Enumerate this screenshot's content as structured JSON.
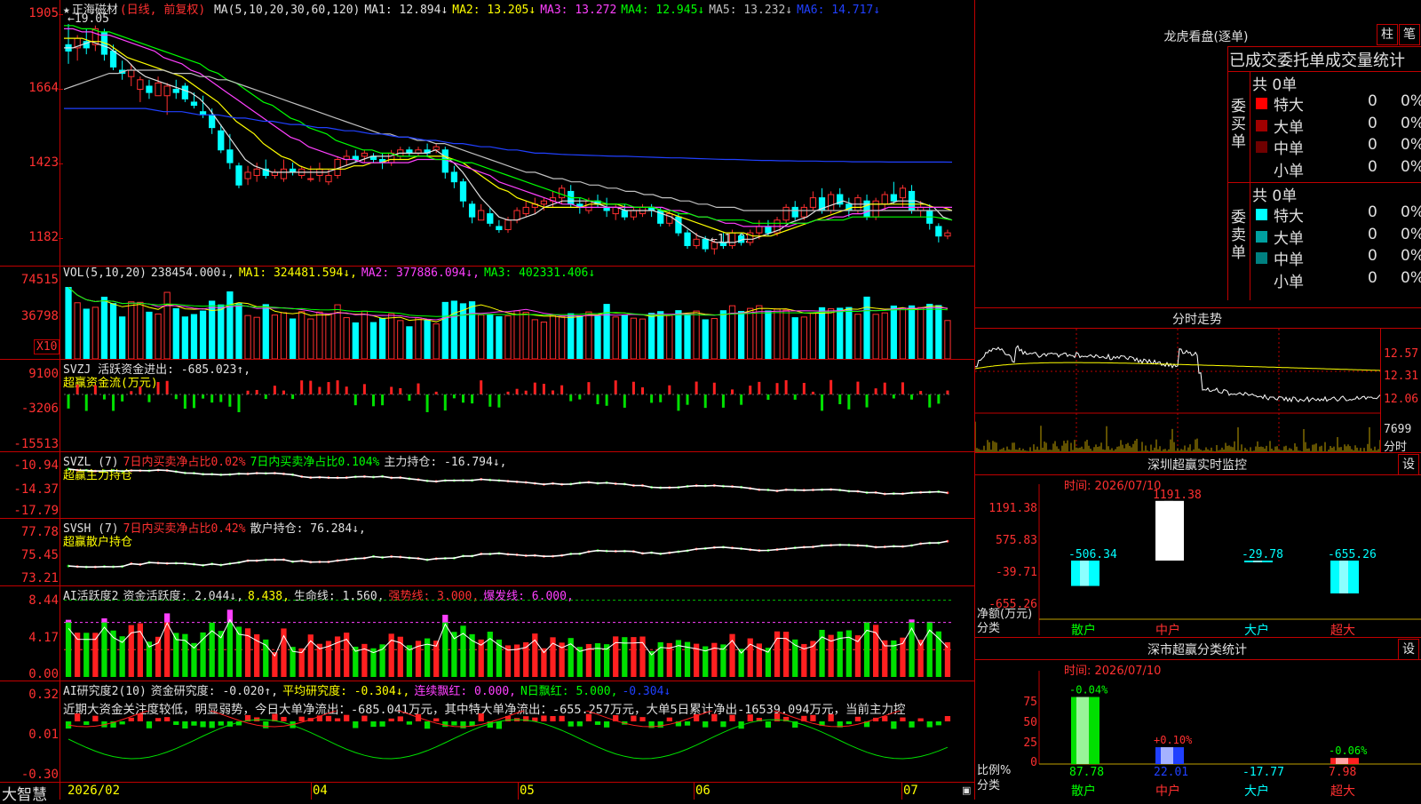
{
  "stock": {
    "star": "★",
    "name": "正海磁材",
    "period_tag": "(日线, 前复权)",
    "ma_legend": [
      {
        "label": "MA(5,10,20,30,60,120)",
        "color": "#e0e0e0"
      },
      {
        "label": "MA1: 12.894↓",
        "color": "#e0e0e0"
      },
      {
        "label": "MA2: 13.205↓",
        "color": "#ffff00"
      },
      {
        "label": "MA3: 13.272",
        "color": "#ff40ff"
      },
      {
        "label": "MA4: 12.945↓",
        "color": "#00ff00"
      },
      {
        "label": "MA5: 13.232↓",
        "color": "#c0c0c0"
      },
      {
        "label": "MA6: 14.717↓",
        "color": "#2040ff"
      }
    ],
    "price_axis": [
      "1905",
      "1664",
      "1423",
      "1182"
    ],
    "high_marker": "19.05",
    "low_marker": "11.82"
  },
  "candles": [
    [
      18.4,
      19.05,
      17.8,
      18.2
    ],
    [
      18.3,
      18.7,
      17.9,
      18.6
    ],
    [
      18.5,
      18.9,
      18.1,
      18.3
    ],
    [
      18.4,
      19.0,
      18.2,
      18.9
    ],
    [
      18.8,
      18.9,
      17.9,
      18.1
    ],
    [
      18.2,
      18.4,
      17.6,
      17.7
    ],
    [
      17.6,
      17.9,
      17.3,
      17.5
    ],
    [
      17.4,
      17.8,
      17.1,
      17.6
    ],
    [
      17.0,
      17.4,
      16.6,
      17.3
    ],
    [
      17.1,
      17.3,
      16.7,
      16.9
    ],
    [
      16.8,
      17.4,
      16.8,
      17.2
    ],
    [
      16.8,
      17.2,
      16.2,
      17.1
    ],
    [
      17.0,
      17.3,
      16.7,
      16.9
    ],
    [
      17.1,
      17.2,
      16.6,
      16.7
    ],
    [
      16.6,
      16.9,
      16.4,
      16.5
    ],
    [
      16.3,
      16.8,
      16.1,
      16.2
    ],
    [
      16.2,
      16.4,
      15.6,
      15.8
    ],
    [
      15.7,
      15.9,
      15.0,
      15.1
    ],
    [
      15.1,
      15.6,
      14.5,
      14.7
    ],
    [
      14.6,
      14.7,
      13.9,
      14.0
    ],
    [
      14.2,
      14.6,
      14.0,
      14.4
    ],
    [
      14.3,
      14.7,
      14.1,
      14.5
    ],
    [
      14.5,
      14.8,
      14.2,
      14.3
    ],
    [
      14.3,
      14.5,
      14.2,
      14.4
    ],
    [
      14.2,
      14.8,
      14.1,
      14.5
    ],
    [
      14.5,
      14.7,
      14.3,
      14.4
    ],
    [
      14.3,
      14.6,
      14.2,
      14.5
    ],
    [
      14.2,
      14.6,
      14.1,
      14.2
    ],
    [
      14.3,
      14.7,
      14.1,
      14.5
    ],
    [
      14.1,
      14.5,
      14.0,
      14.3
    ],
    [
      14.3,
      14.9,
      14.2,
      14.8
    ],
    [
      14.8,
      15.1,
      14.6,
      14.9
    ],
    [
      14.9,
      15.1,
      14.7,
      14.8
    ],
    [
      14.9,
      15.1,
      14.7,
      15.0
    ],
    [
      14.9,
      15.0,
      14.7,
      14.8
    ],
    [
      14.8,
      15.0,
      14.5,
      14.7
    ],
    [
      14.7,
      15.1,
      14.6,
      15.0
    ],
    [
      14.9,
      15.2,
      14.8,
      15.1
    ],
    [
      15.1,
      15.2,
      14.9,
      15.0
    ],
    [
      15.0,
      15.2,
      14.9,
      15.1
    ],
    [
      15.1,
      15.3,
      14.9,
      15.0
    ],
    [
      15.1,
      15.3,
      15.0,
      15.2
    ],
    [
      15.1,
      15.2,
      14.2,
      14.4
    ],
    [
      14.4,
      14.6,
      13.9,
      14.1
    ],
    [
      14.1,
      14.2,
      13.3,
      13.5
    ],
    [
      13.4,
      13.5,
      12.8,
      13.0
    ],
    [
      12.9,
      13.4,
      12.9,
      13.2
    ],
    [
      13.1,
      13.3,
      12.7,
      12.8
    ],
    [
      12.7,
      12.9,
      12.5,
      12.6
    ],
    [
      12.6,
      13.0,
      12.5,
      12.9
    ],
    [
      12.9,
      13.3,
      12.8,
      13.2
    ],
    [
      13.1,
      13.5,
      13.0,
      13.3
    ],
    [
      13.3,
      13.6,
      13.1,
      13.4
    ],
    [
      13.4,
      13.6,
      13.2,
      13.5
    ],
    [
      13.5,
      13.8,
      13.3,
      13.6
    ],
    [
      13.6,
      14.0,
      13.4,
      13.9
    ],
    [
      13.8,
      14.0,
      13.3,
      13.4
    ],
    [
      13.4,
      13.6,
      13.1,
      13.3
    ],
    [
      13.2,
      13.6,
      13.1,
      13.5
    ],
    [
      13.5,
      13.7,
      13.3,
      13.4
    ],
    [
      13.3,
      13.6,
      13.0,
      13.2
    ],
    [
      13.1,
      13.4,
      12.9,
      13.3
    ],
    [
      13.2,
      13.4,
      12.9,
      13.0
    ],
    [
      13.0,
      13.3,
      12.9,
      13.2
    ],
    [
      13.1,
      13.4,
      13.0,
      13.3
    ],
    [
      13.3,
      13.4,
      13.0,
      13.2
    ],
    [
      13.2,
      13.3,
      12.7,
      12.8
    ],
    [
      12.8,
      13.2,
      12.7,
      13.1
    ],
    [
      13.0,
      13.1,
      12.4,
      12.5
    ],
    [
      12.5,
      12.6,
      12.0,
      12.1
    ],
    [
      12.1,
      12.5,
      12.0,
      12.3
    ],
    [
      12.3,
      12.4,
      11.9,
      12.0
    ],
    [
      12.0,
      12.3,
      11.82,
      12.2
    ],
    [
      12.2,
      12.5,
      12.0,
      12.1
    ],
    [
      12.1,
      12.6,
      12.0,
      12.5
    ],
    [
      12.4,
      12.5,
      12.1,
      12.2
    ],
    [
      12.2,
      12.6,
      12.1,
      12.5
    ],
    [
      12.5,
      12.9,
      12.3,
      12.7
    ],
    [
      12.7,
      12.9,
      12.4,
      12.5
    ],
    [
      12.5,
      13.0,
      12.4,
      12.9
    ],
    [
      12.9,
      13.4,
      12.8,
      13.3
    ],
    [
      13.3,
      13.5,
      12.9,
      13.0
    ],
    [
      13.0,
      13.4,
      12.9,
      13.3
    ],
    [
      13.3,
      13.8,
      13.2,
      13.6
    ],
    [
      13.6,
      13.9,
      13.1,
      13.2
    ],
    [
      13.2,
      13.8,
      13.1,
      13.7
    ],
    [
      13.7,
      13.9,
      13.3,
      13.4
    ],
    [
      13.4,
      13.6,
      13.0,
      13.2
    ],
    [
      13.2,
      13.7,
      13.1,
      13.6
    ],
    [
      13.5,
      13.7,
      12.9,
      13.0
    ],
    [
      13.0,
      13.6,
      12.9,
      13.5
    ],
    [
      13.4,
      13.8,
      13.2,
      13.7
    ],
    [
      13.7,
      14.1,
      13.4,
      13.5
    ],
    [
      13.6,
      14.0,
      13.3,
      13.9
    ],
    [
      13.8,
      14.0,
      13.1,
      13.2
    ],
    [
      13.2,
      13.5,
      13.0,
      13.3
    ],
    [
      13.2,
      13.4,
      12.6,
      12.8
    ],
    [
      12.7,
      12.8,
      12.2,
      12.4
    ],
    [
      12.4,
      12.6,
      12.3,
      12.5
    ]
  ],
  "ma_series": {
    "ma1": [
      18.3,
      18.3,
      18.4,
      18.5,
      18.4,
      18.3,
      18.1,
      17.9,
      17.6,
      17.4,
      17.3,
      17.2,
      17.1,
      17.0,
      16.9,
      16.7,
      16.4,
      16.0,
      15.6,
      15.2,
      14.8,
      14.6,
      14.5,
      14.4,
      14.4,
      14.4,
      14.4,
      14.4,
      14.4,
      14.4,
      14.5,
      14.6,
      14.7,
      14.8,
      14.9,
      14.9,
      14.9,
      15.0,
      15.0,
      15.0,
      15.0,
      15.1,
      14.9,
      14.7,
      14.4,
      14.0,
      13.6,
      13.3,
      13.0,
      12.9,
      12.9,
      13.0,
      13.1,
      13.3,
      13.4,
      13.5,
      13.5,
      13.5,
      13.5,
      13.4,
      13.3,
      13.3,
      13.2,
      13.2,
      13.2,
      13.2,
      13.1,
      13.0,
      12.8,
      12.6,
      12.4,
      12.3,
      12.2,
      12.2,
      12.2,
      12.3,
      12.3,
      12.4,
      12.5,
      12.6,
      12.8,
      12.9,
      13.0,
      13.2,
      13.3,
      13.4,
      13.5,
      13.4,
      13.4,
      13.4,
      13.4,
      13.4,
      13.5,
      13.5,
      13.5,
      13.4,
      13.3,
      13.0,
      12.9
    ],
    "ma2": [
      18.6,
      18.6,
      18.6,
      18.5,
      18.5,
      18.4,
      18.2,
      18.0,
      17.9,
      17.8,
      17.7,
      17.6,
      17.5,
      17.4,
      17.2,
      17.0,
      16.8,
      16.6,
      16.3,
      16.0,
      15.8,
      15.6,
      15.3,
      15.1,
      14.9,
      14.8,
      14.6,
      14.5,
      14.5,
      14.5,
      14.5,
      14.5,
      14.6,
      14.6,
      14.7,
      14.7,
      14.8,
      14.8,
      14.8,
      14.9,
      14.9,
      14.9,
      14.9,
      14.8,
      14.7,
      14.5,
      14.3,
      14.1,
      13.9,
      13.8,
      13.6,
      13.5,
      13.4,
      13.3,
      13.3,
      13.3,
      13.3,
      13.3,
      13.4,
      13.4,
      13.4,
      13.4,
      13.3,
      13.3,
      13.3,
      13.3,
      13.2,
      13.1,
      13.0,
      12.9,
      12.8,
      12.7,
      12.6,
      12.5,
      12.5,
      12.5,
      12.4,
      12.4,
      12.4,
      12.5,
      12.6,
      12.7,
      12.8,
      12.9,
      13.0,
      13.1,
      13.2,
      13.3,
      13.3,
      13.4,
      13.4,
      13.4,
      13.4,
      13.4,
      13.4,
      13.4,
      13.3,
      13.3,
      13.2
    ],
    "ma3": [
      18.9,
      18.9,
      18.8,
      18.8,
      18.7,
      18.7,
      18.6,
      18.5,
      18.4,
      18.3,
      18.2,
      18.0,
      17.9,
      17.8,
      17.6,
      17.5,
      17.3,
      17.1,
      16.9,
      16.7,
      16.5,
      16.3,
      16.1,
      15.9,
      15.7,
      15.5,
      15.4,
      15.2,
      15.1,
      15.0,
      14.9,
      14.8,
      14.8,
      14.7,
      14.7,
      14.7,
      14.7,
      14.7,
      14.7,
      14.8,
      14.8,
      14.8,
      14.8,
      14.7,
      14.6,
      14.5,
      14.4,
      14.3,
      14.1,
      14.0,
      13.9,
      13.8,
      13.7,
      13.6,
      13.5,
      13.4,
      13.4,
      13.3,
      13.3,
      13.3,
      13.3,
      13.3,
      13.3,
      13.3,
      13.3,
      13.3,
      13.3,
      13.2,
      13.2,
      13.1,
      13.0,
      13.0,
      12.9,
      12.8,
      12.8,
      12.7,
      12.7,
      12.7,
      12.7,
      12.7,
      12.7,
      12.8,
      12.8,
      12.9,
      12.9,
      13.0,
      13.0,
      13.1,
      13.1,
      13.2,
      13.2,
      13.3,
      13.3,
      13.3,
      13.3,
      13.3,
      13.3,
      13.3,
      13.3
    ],
    "ma4": [
      19.0,
      19.0,
      18.9,
      18.9,
      18.8,
      18.8,
      18.7,
      18.6,
      18.5,
      18.4,
      18.3,
      18.2,
      18.1,
      18.0,
      17.9,
      17.8,
      17.6,
      17.5,
      17.3,
      17.2,
      17.0,
      16.8,
      16.6,
      16.5,
      16.3,
      16.1,
      16.0,
      15.8,
      15.7,
      15.6,
      15.4,
      15.3,
      15.2,
      15.1,
      15.1,
      15.0,
      15.0,
      14.9,
      14.9,
      14.9,
      14.9,
      14.8,
      14.8,
      14.8,
      14.7,
      14.7,
      14.6,
      14.5,
      14.4,
      14.3,
      14.2,
      14.1,
      14.0,
      13.9,
      13.8,
      13.7,
      13.6,
      13.6,
      13.5,
      13.5,
      13.4,
      13.4,
      13.4,
      13.3,
      13.3,
      13.3,
      13.2,
      13.2,
      13.1,
      13.1,
      13.0,
      13.0,
      12.9,
      12.9,
      12.9,
      12.9,
      12.8,
      12.8,
      12.8,
      12.8,
      12.8,
      12.8,
      12.8,
      12.9,
      12.9,
      12.9,
      12.9,
      13.0,
      13.0,
      13.0,
      13.0,
      13.0,
      13.0,
      13.0,
      13.0,
      13.0,
      13.0,
      12.95,
      12.9
    ],
    "ma5": [
      17.0,
      17.1,
      17.2,
      17.3,
      17.4,
      17.5,
      17.5,
      17.6,
      17.6,
      17.6,
      17.6,
      17.6,
      17.5,
      17.5,
      17.5,
      17.4,
      17.4,
      17.3,
      17.3,
      17.2,
      17.1,
      17.0,
      16.9,
      16.8,
      16.7,
      16.6,
      16.5,
      16.4,
      16.3,
      16.2,
      16.1,
      16.0,
      15.9,
      15.8,
      15.7,
      15.6,
      15.6,
      15.5,
      15.5,
      15.4,
      15.4,
      15.3,
      15.3,
      15.2,
      15.1,
      15.0,
      14.9,
      14.8,
      14.7,
      14.6,
      14.5,
      14.4,
      14.4,
      14.3,
      14.2,
      14.2,
      14.1,
      14.1,
      14.0,
      14.0,
      13.9,
      13.9,
      13.8,
      13.8,
      13.7,
      13.7,
      13.6,
      13.6,
      13.5,
      13.5,
      13.4,
      13.4,
      13.3,
      13.3,
      13.3,
      13.2,
      13.2,
      13.2,
      13.2,
      13.2,
      13.2,
      13.2,
      13.2,
      13.2,
      13.2,
      13.2,
      13.2,
      13.2,
      13.2,
      13.2,
      13.2,
      13.2,
      13.2,
      13.2,
      13.2,
      13.2,
      13.2,
      13.2,
      13.2
    ],
    "ma6": [
      16.4,
      16.4,
      16.4,
      16.4,
      16.4,
      16.4,
      16.4,
      16.4,
      16.4,
      16.4,
      16.35,
      16.3,
      16.3,
      16.3,
      16.25,
      16.2,
      16.2,
      16.2,
      16.15,
      16.1,
      16.1,
      16.05,
      16.0,
      16.0,
      15.95,
      15.9,
      15.9,
      15.85,
      15.8,
      15.8,
      15.75,
      15.7,
      15.7,
      15.65,
      15.6,
      15.6,
      15.55,
      15.5,
      15.5,
      15.45,
      15.4,
      15.4,
      15.35,
      15.3,
      15.3,
      15.25,
      15.2,
      15.2,
      15.15,
      15.1,
      15.1,
      15.05,
      15.0,
      15.0,
      14.98,
      14.96,
      14.95,
      14.94,
      14.93,
      14.92,
      14.91,
      14.9,
      14.9,
      14.89,
      14.88,
      14.87,
      14.86,
      14.85,
      14.85,
      14.84,
      14.83,
      14.82,
      14.81,
      14.8,
      14.8,
      14.79,
      14.78,
      14.77,
      14.77,
      14.76,
      14.76,
      14.75,
      14.75,
      14.75,
      14.74,
      14.74,
      14.74,
      14.73,
      14.73,
      14.73,
      14.73,
      14.72,
      14.72,
      14.72,
      14.72,
      14.72,
      14.72,
      14.72,
      14.717
    ]
  },
  "vol": {
    "legend": [
      {
        "label": "VOL(5,10,20)",
        "color": "#e0e0e0"
      },
      {
        "label": "238454.000↓,",
        "color": "#e0e0e0"
      },
      {
        "label": "MA1: 324481.594↓,",
        "color": "#ffff00"
      },
      {
        "label": "MA2: 377886.094↓,",
        "color": "#ff40ff"
      },
      {
        "label": "MA3: 402331.406↓",
        "color": "#00ff00"
      }
    ],
    "axis": [
      "74515",
      "36798"
    ],
    "unit": "X10"
  },
  "svzj": {
    "legend": [
      {
        "label": "SVZJ  活跃资金进出: -685.023↑,",
        "color": "#e0e0e0"
      }
    ],
    "sub": "超赢资金流(万元)",
    "axis": [
      "9100",
      "-3206",
      "-15513"
    ]
  },
  "svzl": {
    "legend": [
      {
        "label": "SVZL (7)",
        "color": "#e0e0e0"
      },
      {
        "label": "7日内买卖净占比0.02%",
        "color": "#ff3030"
      },
      {
        "label": "7日内买卖净占比0.104%",
        "color": "#00ff00"
      },
      {
        "label": "主力持仓: -16.794↓,",
        "color": "#e0e0e0"
      }
    ],
    "sub": "超赢主力持仓",
    "axis": [
      "-10.94",
      "-14.37",
      "-17.79"
    ]
  },
  "svsh": {
    "legend": [
      {
        "label": "SVSH (7)",
        "color": "#e0e0e0"
      },
      {
        "label": "7日内买卖净占比0.42%",
        "color": "#ff3030"
      },
      {
        "label": "散户持仓: 76.284↓,",
        "color": "#e0e0e0"
      }
    ],
    "sub": "超赢散户持仓",
    "axis": [
      "77.78",
      "75.45",
      "73.21"
    ]
  },
  "ai_active": {
    "legend": [
      {
        "label": "AI活跃度2",
        "color": "#e0e0e0"
      },
      {
        "label": "资金活跃度: 2.044↓,",
        "color": "#e0e0e0"
      },
      {
        "label": "8.438,",
        "color": "#ffff00"
      },
      {
        "label": "生命线: 1.560,",
        "color": "#e0e0e0"
      },
      {
        "label": "强势线: 3.000,",
        "color": "#ff3030"
      },
      {
        "label": "爆发线: 6.000,",
        "color": "#ff40ff"
      }
    ],
    "axis": [
      "8.44",
      "4.17",
      "0.00"
    ]
  },
  "ai_research": {
    "legend": [
      {
        "label": "AI研究度2(10)",
        "color": "#e0e0e0"
      },
      {
        "label": "资金研究度: -0.020↑,",
        "color": "#e0e0e0"
      },
      {
        "label": "平均研究度: -0.304↓,",
        "color": "#ffff00"
      },
      {
        "label": "连续飘红: 0.000,",
        "color": "#ff40ff"
      },
      {
        "label": "N日飘红: 5.000,",
        "color": "#00ff00"
      },
      {
        "label": "-0.304↓",
        "color": "#2040ff"
      }
    ],
    "comment": "近期大资金关注度较低，明显弱势，今日大单净流出：-685.041万元，其中特大单净流出：-655.257万元，大单5日累计净出-16539.094万元，当前主力控",
    "axis": [
      "0.32",
      "0.01",
      "-0.30"
    ]
  },
  "timeline": {
    "brand": "大智慧",
    "labels": [
      "2026/02",
      "04",
      "05",
      "06",
      "07"
    ]
  },
  "right": {
    "lhb": {
      "title": "龙虎看盘(逐单)",
      "btn_bar": "柱",
      "btn_pen": "笔",
      "tabs": [
        "已成交",
        "委托单",
        "成交量统计"
      ],
      "buy_label": "委买单",
      "sell_label": "委卖单",
      "buy_total": "共 0单",
      "sell_total": "共 0单",
      "buy_rows": [
        {
          "name": "特大",
          "count": "0",
          "pct": "0%",
          "color": "#ff0000"
        },
        {
          "name": "大单",
          "count": "0",
          "pct": "0%",
          "color": "#a00000"
        },
        {
          "name": "中单",
          "count": "0",
          "pct": "0%",
          "color": "#700000"
        },
        {
          "name": "小单",
          "count": "0",
          "pct": "0%",
          "color": ""
        }
      ],
      "sell_rows": [
        {
          "name": "特大",
          "count": "0",
          "pct": "0%",
          "color": "#00ffff"
        },
        {
          "name": "大单",
          "count": "0",
          "pct": "0%",
          "color": "#00a0a0"
        },
        {
          "name": "中单",
          "count": "0",
          "pct": "0%",
          "color": "#008080"
        },
        {
          "name": "小单",
          "count": "0",
          "pct": "0%",
          "color": ""
        }
      ]
    },
    "intraday": {
      "title": "分时走势",
      "axis": [
        "12.57",
        "12.31",
        "12.06"
      ],
      "vol_label": "7699",
      "vol_unit": "分时"
    },
    "sz_monitor": {
      "title": "深圳超赢实时监控",
      "btn": "设",
      "time": "时间: 2026/07/10",
      "axis": [
        "1191.38",
        "575.83",
        "-39.71",
        "-655.26"
      ],
      "ylabel": "净额(万元)",
      "xlabel": "分类",
      "categories": [
        "散户",
        "中户",
        "大户",
        "超大"
      ],
      "values": [
        -506.34,
        1191.38,
        -29.78,
        -655.26
      ],
      "value_labels": [
        "-506.34",
        "1191.38",
        "-29.78",
        "-655.26"
      ]
    },
    "sz_class": {
      "title": "深市超赢分类统计",
      "btn": "设",
      "time": "时间: 2026/07/10",
      "axis": [
        "75",
        "50",
        "25",
        "0"
      ],
      "ylabel": "比例%",
      "xlabel": "分类",
      "categories": [
        "散户",
        "中户",
        "大户",
        "超大"
      ],
      "values": [
        87.78,
        22.01,
        -17.77,
        7.98
      ],
      "value_labels": [
        "87.78",
        "22.01",
        "-17.77",
        "7.98"
      ],
      "top_labels": [
        "-0.04%",
        "+0.10%",
        "",
        "-0.06%"
      ]
    }
  },
  "accent": {
    "grid": "#c00000",
    "up": "#ff3030",
    "down": "#00ffff"
  }
}
